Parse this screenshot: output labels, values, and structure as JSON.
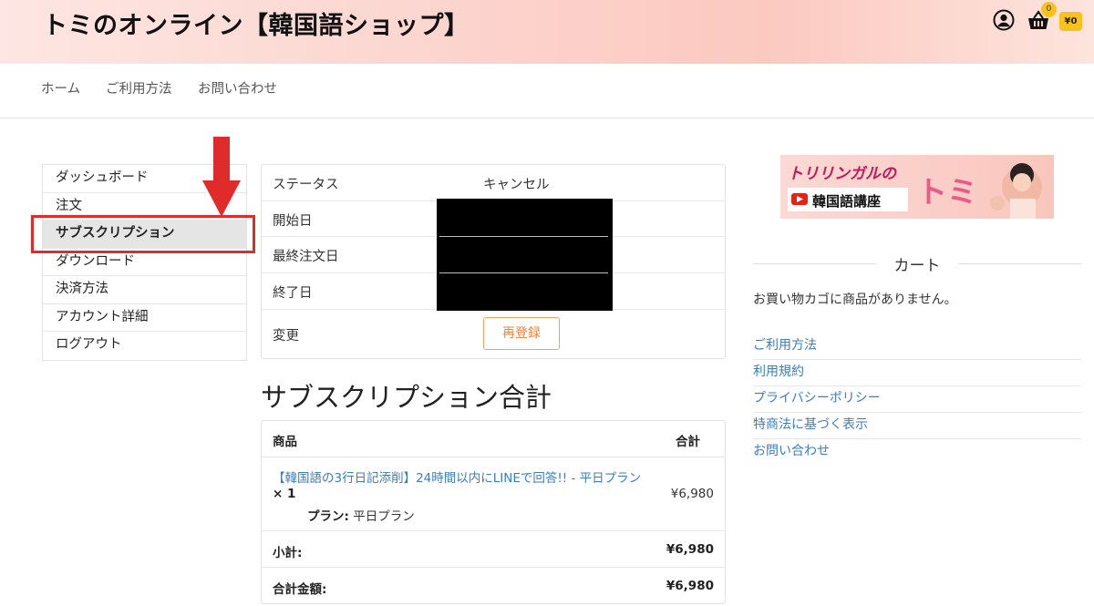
{
  "header": {
    "site_title": "トミのオンライン【韓国語ショップ】",
    "cart_count": "0",
    "cart_total": "¥0"
  },
  "nav": {
    "items": [
      "ホーム",
      "ご利用方法",
      "お問い合わせ"
    ]
  },
  "account_nav": {
    "items": [
      "ダッシュボード",
      "注文",
      "サブスクリプション",
      "ダウンロード",
      "決済方法",
      "アカウント詳細",
      "ログアウト"
    ],
    "active": "サブスクリプション"
  },
  "subscription": {
    "rows": [
      {
        "label": "ステータス",
        "value": "キャンセル"
      },
      {
        "label": "開始日",
        "value": ""
      },
      {
        "label": "最終注文日",
        "value": ""
      },
      {
        "label": "終了日",
        "value": ""
      },
      {
        "label": "変更",
        "value": ""
      }
    ],
    "renew_button": "再登録"
  },
  "totals": {
    "title": "サブスクリプション合計",
    "col_product": "商品",
    "col_total": "合計",
    "product_name": "【韓国語の3行日記添削】24時間以内にLINEで回答!! - 平日プラン",
    "quantity": "× 1",
    "plan_label": "プラン:",
    "plan_value": "平日プラン",
    "line_total": "¥6,980",
    "subtotal_label": "小計:",
    "subtotal_value": "¥6,980",
    "grand_label": "合計金額:",
    "grand_value": "¥6,980"
  },
  "sidebar": {
    "banner_title": "トリリンガルの",
    "banner_sub": "韓国語講座",
    "banner_name": "トミ",
    "cart_heading": "カート",
    "cart_empty": "お買い物カゴに商品がありません。",
    "links": [
      "ご利用方法",
      "利用規約",
      "プライバシーポリシー",
      "特商法に基づく表示",
      "お問い合わせ"
    ]
  },
  "colors": {
    "accent_orange": "#e9853f",
    "link_blue": "#3a7dc1",
    "highlight_red": "#e02b2b",
    "badge_yellow": "#f7c21e"
  }
}
